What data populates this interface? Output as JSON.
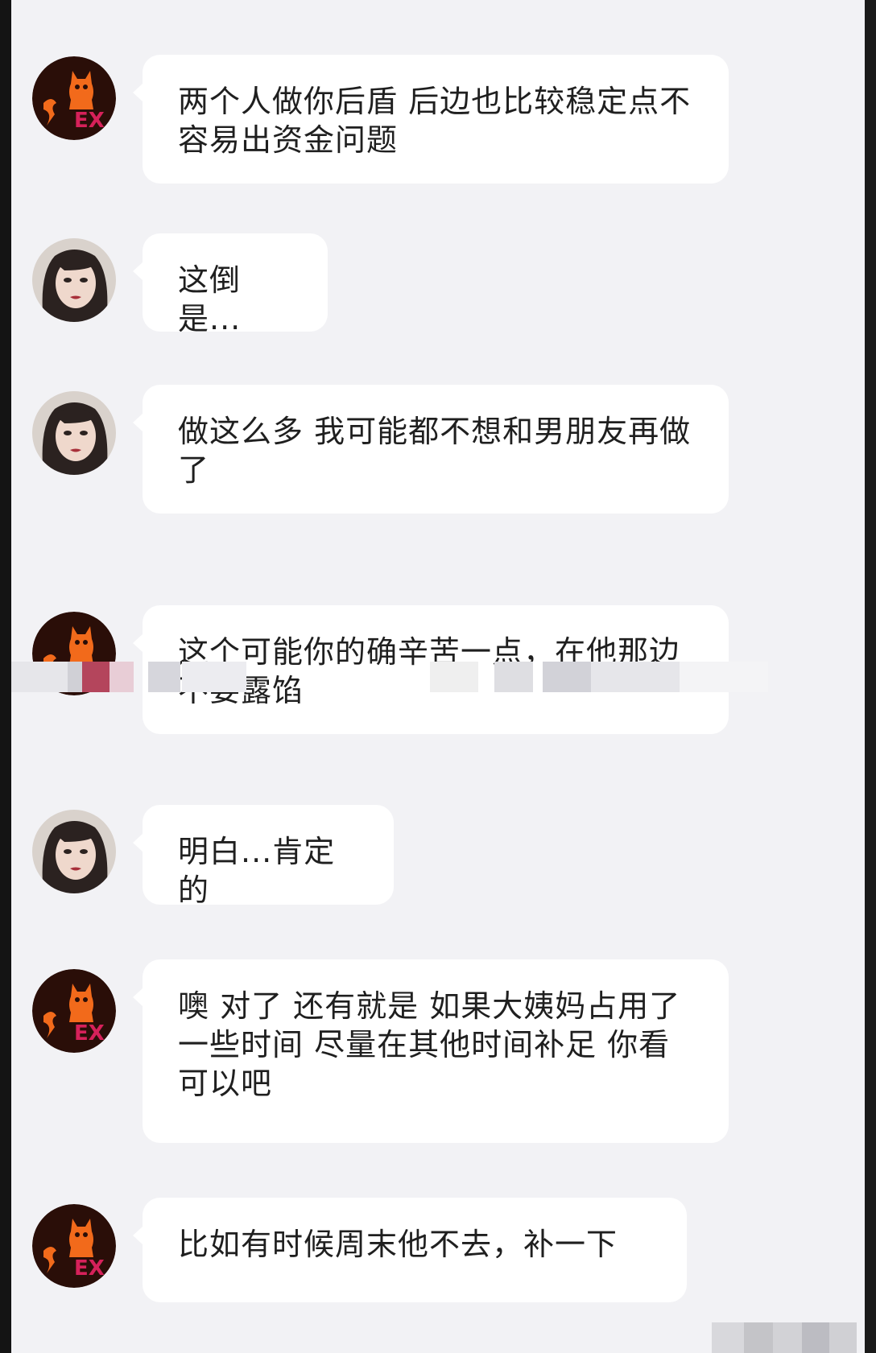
{
  "chat": {
    "messages": [
      {
        "sender": "partner",
        "avatar_icon": "cat-ex-logo-icon",
        "text": "两个人做你后盾 后边也比较稳定点不容易出资金问题"
      },
      {
        "sender": "user",
        "avatar_icon": "woman-portrait-icon",
        "text": "这倒是..."
      },
      {
        "sender": "user",
        "avatar_icon": "woman-portrait-icon",
        "text": "做这么多 我可能都不想和男朋友再做了"
      },
      {
        "sender": "partner",
        "avatar_icon": "cat-ex-logo-icon",
        "text": "这个可能你的确辛苦一点，在他那边不要露馅"
      },
      {
        "sender": "user",
        "avatar_icon": "woman-portrait-icon",
        "text": "明白...肯定的"
      },
      {
        "sender": "partner",
        "avatar_icon": "cat-ex-logo-icon",
        "text": "噢 对了 还有就是 如果大姨妈占用了一些时间 尽量在其他时间补足 你看可以吧"
      },
      {
        "sender": "partner",
        "avatar_icon": "cat-ex-logo-icon",
        "text": "比如有时候周末他不去，补一下"
      }
    ]
  },
  "colors": {
    "background": "#f2f2f5",
    "bubble": "#ffffff",
    "text": "#1f1f1f",
    "logo_bg": "#2a0e08",
    "logo_cat": "#f26a1b",
    "logo_letters": "#d6215a"
  }
}
